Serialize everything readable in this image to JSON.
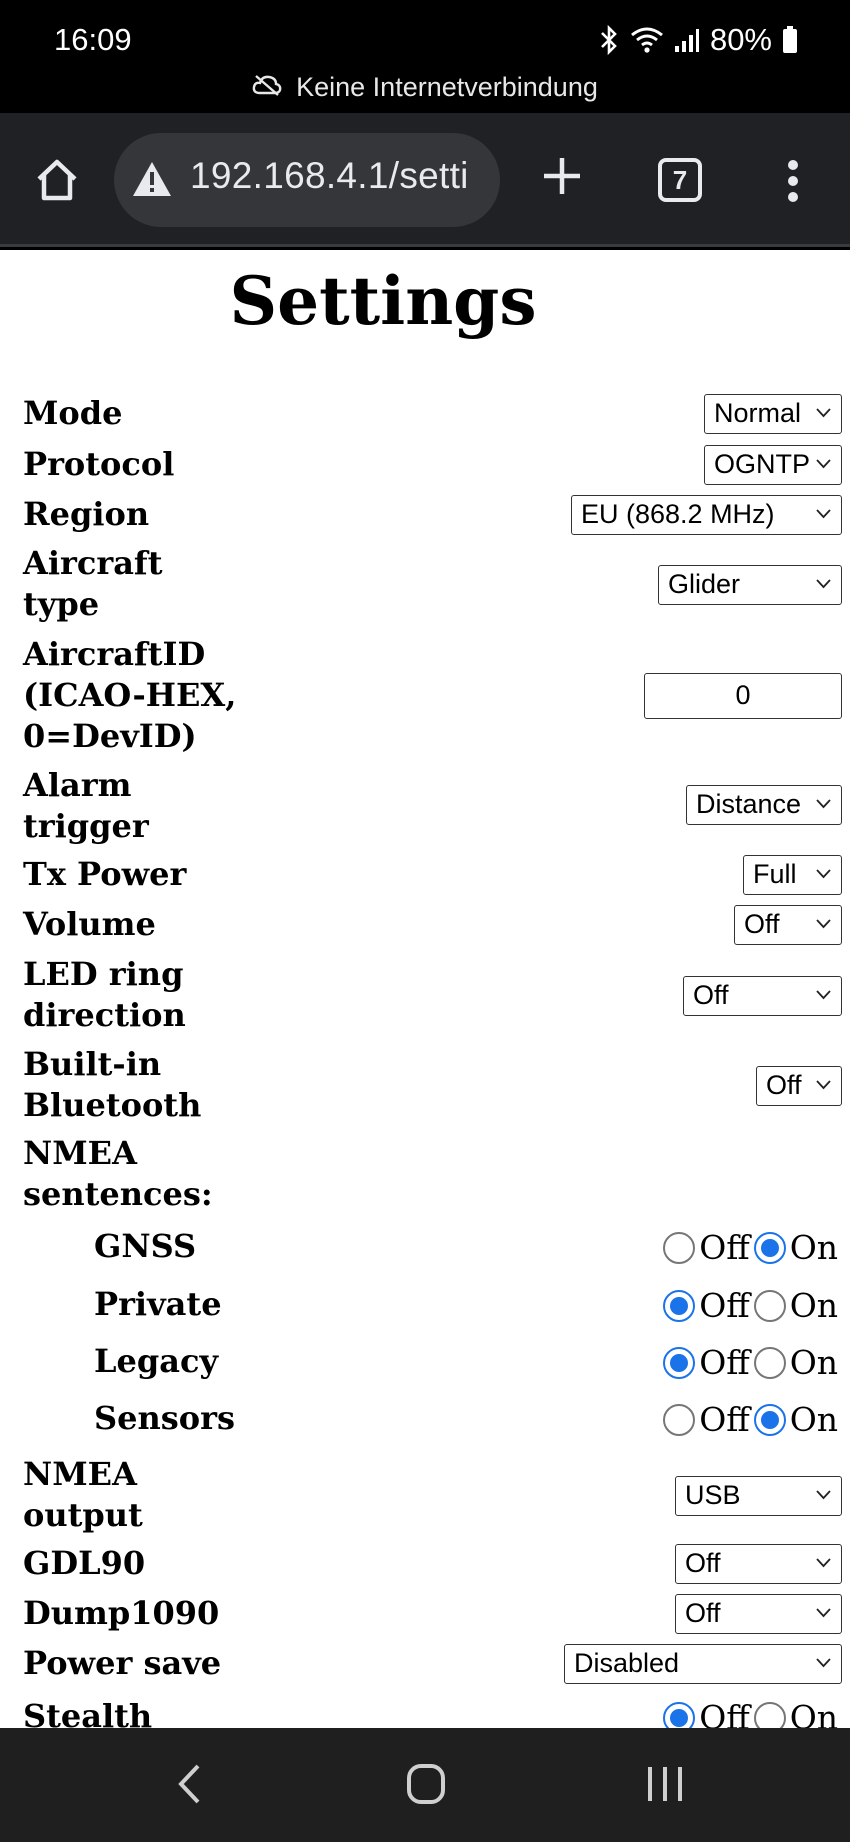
{
  "status_bar": {
    "time": "16:09",
    "battery": "80%",
    "network_notice": "Keine Internetverbindung"
  },
  "browser": {
    "url": "192.168.4.1/setti",
    "tab_count": "7"
  },
  "page": {
    "title": "Settings",
    "fields": {
      "mode": {
        "label": "Mode",
        "value": "Normal"
      },
      "protocol": {
        "label": "Protocol",
        "value": "OGNTP"
      },
      "region": {
        "label": "Region",
        "value": "EU (868.2 MHz)"
      },
      "aircraft_type": {
        "label1": "Aircraft",
        "label2": "type",
        "value": "Glider"
      },
      "aircraft_id": {
        "label1": "AircraftID",
        "label2": "(ICAO-HEX,",
        "label3": "0=DevID)",
        "value": "0"
      },
      "alarm_trigger": {
        "label1": "Alarm",
        "label2": "trigger",
        "value": "Distance"
      },
      "tx_power": {
        "label": "Tx Power",
        "value": "Full"
      },
      "volume": {
        "label": "Volume",
        "value": "Off"
      },
      "led_ring": {
        "label1": "LED ring",
        "label2": "direction",
        "value": "Off"
      },
      "bluetooth": {
        "label1": "Built-in",
        "label2": "Bluetooth",
        "value": "Off"
      },
      "nmea_sentences": {
        "label1": "NMEA",
        "label2": "sentences:"
      },
      "gnss": {
        "label": "GNSS",
        "selected": "On"
      },
      "private": {
        "label": "Private",
        "selected": "Off"
      },
      "legacy": {
        "label": "Legacy",
        "selected": "Off"
      },
      "sensors": {
        "label": "Sensors",
        "selected": "On"
      },
      "nmea_output": {
        "label1": "NMEA",
        "label2": "output",
        "value": "USB"
      },
      "gdl90": {
        "label": "GDL90",
        "value": "Off"
      },
      "dump1090": {
        "label": "Dump1090",
        "value": "Off"
      },
      "power_save": {
        "label": "Power save",
        "value": "Disabled"
      },
      "stealth": {
        "label": "Stealth",
        "selected": "Off"
      }
    },
    "radio_off": "Off",
    "radio_on": "On"
  }
}
